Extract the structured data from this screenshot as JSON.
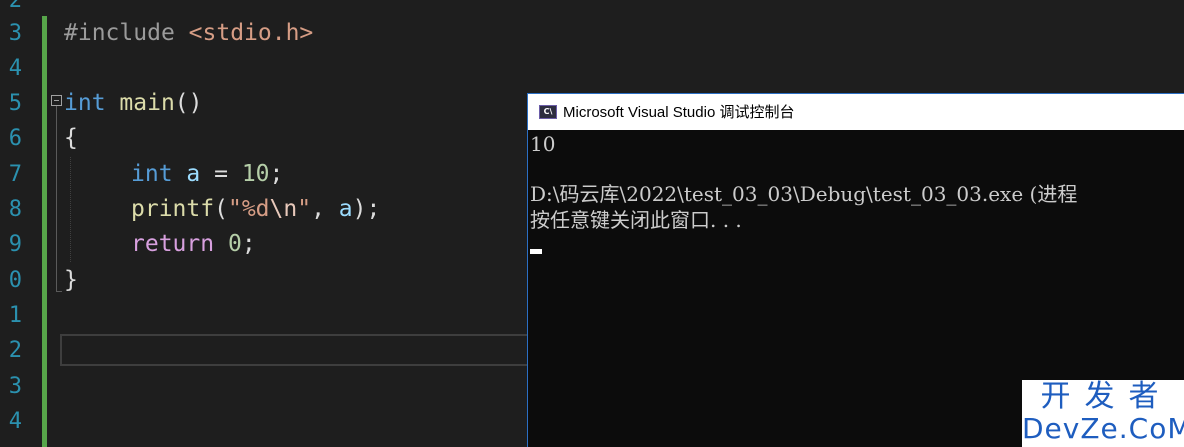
{
  "editor": {
    "line_numbers": [
      "2",
      "3",
      "4",
      "5",
      "6",
      "7",
      "8",
      "9",
      "0",
      "1",
      "2",
      "3",
      "4"
    ],
    "code": {
      "l3": {
        "hash": "#",
        "include": "include",
        "header": "<stdio.h>"
      },
      "l5": {
        "type": "int",
        "name": "main",
        "parens": "()"
      },
      "l6": {
        "brace": "{"
      },
      "l7": {
        "type": "int",
        "var": "a",
        "op": " = ",
        "num": "10",
        "semi": ";"
      },
      "l8": {
        "fn": "printf",
        "open": "(",
        "str1": "\"",
        "fmt": "%d",
        "esc": "\\n",
        "str2": "\"",
        "comma": ", ",
        "var": "a",
        "close": ");"
      },
      "l9": {
        "kw": "return",
        "num": "0",
        "semi": ";"
      },
      "l10": {
        "brace": "}"
      }
    }
  },
  "console": {
    "title": "Microsoft Visual Studio 调试控制台",
    "icon_label": "C\\",
    "lines": [
      "10",
      "",
      "D:\\码云库\\2022\\test_03_03\\Debug\\test_03_03.exe (进程",
      "按任意键关闭此窗口. . ."
    ]
  },
  "watermark": {
    "top": "开发者",
    "bottom": "DevZe.CoM"
  },
  "colors": {
    "background": "#1e1e1e",
    "line_number": "#2b91af",
    "keyword": "#569cd6",
    "function": "#dcdcaa",
    "string": "#d69d85",
    "number": "#b5cea8",
    "change_bar": "#57a64a",
    "console_bg": "#0c0c0c",
    "watermark": "#1e5dbf"
  }
}
